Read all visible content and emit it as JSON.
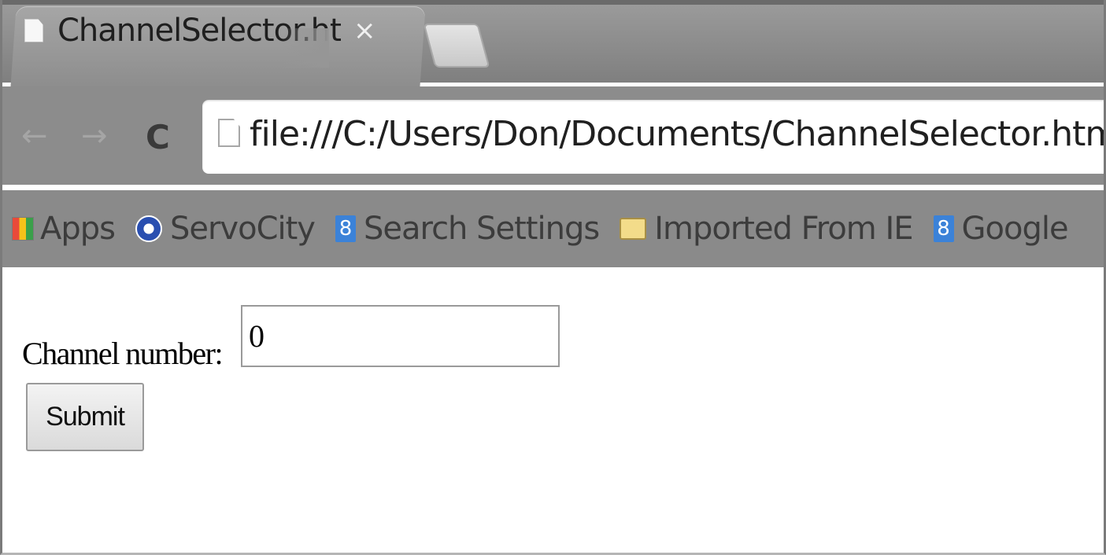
{
  "browser": {
    "tab": {
      "title": "ChannelSelector.htm",
      "close_glyph": "×"
    },
    "nav": {
      "back_glyph": "←",
      "forward_glyph": "→",
      "reload_glyph": "C"
    },
    "address": {
      "url": "file:///C:/Users/Don/Documents/ChannelSelector.html"
    },
    "bookmarks": [
      {
        "label": "Apps",
        "icon": "apps-icon"
      },
      {
        "label": "ServoCity",
        "icon": "servocity-icon"
      },
      {
        "label": "Search Settings",
        "icon": "google-icon"
      },
      {
        "label": "Imported From IE",
        "icon": "folder-icon"
      },
      {
        "label": "Google",
        "icon": "google-icon"
      }
    ]
  },
  "page": {
    "channel_label": "Channel number:",
    "channel_value": "0",
    "submit_label": "Submit"
  }
}
